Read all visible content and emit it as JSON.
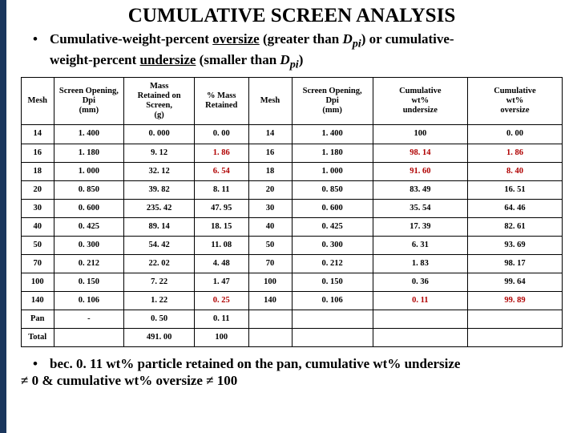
{
  "title": "CUMULATIVE SCREEN ANALYSIS",
  "bullet": {
    "pre": "Cumulative-weight-percent ",
    "u1": "oversize",
    "mid1": " (greater than ",
    "sym": "D",
    "sub": "pi",
    "after_sym": ") or cumulative-",
    "line2pre": "weight-percent ",
    "u2": "undersize",
    "line2mid": " (smaller than ",
    "line2end": ")"
  },
  "headers": {
    "h1": "Mesh",
    "h2a": "Screen Opening,",
    "h2b": "Dpi",
    "h2c": "(mm)",
    "h3a": "Mass",
    "h3b": "Retained on",
    "h3c": "Screen,",
    "h3d": "(g)",
    "h4a": "% Mass",
    "h4b": "Retained",
    "h5": "Mesh",
    "h6a": "Screen Opening,",
    "h6b": "Dpi",
    "h6c": "(mm)",
    "h7a": "Cumulative",
    "h7b": "wt%",
    "h7c": "undersize",
    "h8a": "Cumulative",
    "h8b": "wt%",
    "h8c": "oversize"
  },
  "rows": [
    {
      "m": "14",
      "o": "1. 400",
      "mr": "0. 000",
      "pr": "0. 00",
      "m2": "14",
      "o2": "1. 400",
      "cu": "100",
      "co": "0. 00"
    },
    {
      "m": "16",
      "o": "1. 180",
      "mr": "9. 12",
      "pr": "1. 86",
      "m2": "16",
      "o2": "1. 180",
      "cu": "98. 14",
      "co": "1. 86",
      "red": true
    },
    {
      "m": "18",
      "o": "1. 000",
      "mr": "32. 12",
      "pr": "6. 54",
      "m2": "18",
      "o2": "1. 000",
      "cu": "91. 60",
      "co": "8. 40",
      "red": true
    },
    {
      "m": "20",
      "o": "0. 850",
      "mr": "39. 82",
      "pr": "8. 11",
      "m2": "20",
      "o2": "0. 850",
      "cu": "83. 49",
      "co": "16. 51"
    },
    {
      "m": "30",
      "o": "0. 600",
      "mr": "235. 42",
      "pr": "47. 95",
      "m2": "30",
      "o2": "0. 600",
      "cu": "35. 54",
      "co": "64. 46"
    },
    {
      "m": "40",
      "o": "0. 425",
      "mr": "89. 14",
      "pr": "18. 15",
      "m2": "40",
      "o2": "0. 425",
      "cu": "17. 39",
      "co": "82. 61"
    },
    {
      "m": "50",
      "o": "0. 300",
      "mr": "54. 42",
      "pr": "11. 08",
      "m2": "50",
      "o2": "0. 300",
      "cu": "6. 31",
      "co": "93. 69"
    },
    {
      "m": "70",
      "o": "0. 212",
      "mr": "22. 02",
      "pr": "4. 48",
      "m2": "70",
      "o2": "0. 212",
      "cu": "1. 83",
      "co": "98. 17"
    },
    {
      "m": "100",
      "o": "0. 150",
      "mr": "7. 22",
      "pr": "1. 47",
      "m2": "100",
      "o2": "0. 150",
      "cu": "0. 36",
      "co": "99. 64"
    },
    {
      "m": "140",
      "o": "0. 106",
      "mr": "1. 22",
      "pr": "0. 25",
      "m2": "140",
      "o2": "0. 106",
      "cu": "0. 11",
      "co": "99. 89",
      "red": true
    }
  ],
  "pan": {
    "m": "Pan",
    "o": "-",
    "mr": "0. 50",
    "pr": "0. 11"
  },
  "total": {
    "m": "Total",
    "mr": "491. 00",
    "pr": "100"
  },
  "footnote": {
    "pre": "bec. 0. 11 wt% particle retained on the pan, cumulative wt% undersize",
    "line2": "≠ 0 & cumulative wt% oversize ≠ 100"
  },
  "chart_data": {
    "type": "table",
    "title": "CUMULATIVE SCREEN ANALYSIS",
    "columns": [
      "Mesh",
      "Screen Opening Dpi (mm)",
      "Mass Retained on Screen (g)",
      "% Mass Retained",
      "Mesh",
      "Screen Opening Dpi (mm)",
      "Cumulative wt% undersize",
      "Cumulative wt% oversize"
    ],
    "data": [
      [
        14,
        1.4,
        0.0,
        0.0,
        14,
        1.4,
        100,
        0.0
      ],
      [
        16,
        1.18,
        9.12,
        1.86,
        16,
        1.18,
        98.14,
        1.86
      ],
      [
        18,
        1.0,
        32.12,
        6.54,
        18,
        1.0,
        91.6,
        8.4
      ],
      [
        20,
        0.85,
        39.82,
        8.11,
        20,
        0.85,
        83.49,
        16.51
      ],
      [
        30,
        0.6,
        235.42,
        47.95,
        30,
        0.6,
        35.54,
        64.46
      ],
      [
        40,
        0.425,
        89.14,
        18.15,
        40,
        0.425,
        17.39,
        82.61
      ],
      [
        50,
        0.3,
        54.42,
        11.08,
        50,
        0.3,
        6.31,
        93.69
      ],
      [
        70,
        0.212,
        22.02,
        4.48,
        70,
        0.212,
        1.83,
        98.17
      ],
      [
        100,
        0.15,
        7.22,
        1.47,
        100,
        0.15,
        0.36,
        99.64
      ],
      [
        140,
        0.106,
        1.22,
        0.25,
        140,
        0.106,
        0.11,
        99.89
      ],
      [
        "Pan",
        "-",
        0.5,
        0.11,
        null,
        null,
        null,
        null
      ],
      [
        "Total",
        null,
        491.0,
        100,
        null,
        null,
        null,
        null
      ]
    ]
  }
}
